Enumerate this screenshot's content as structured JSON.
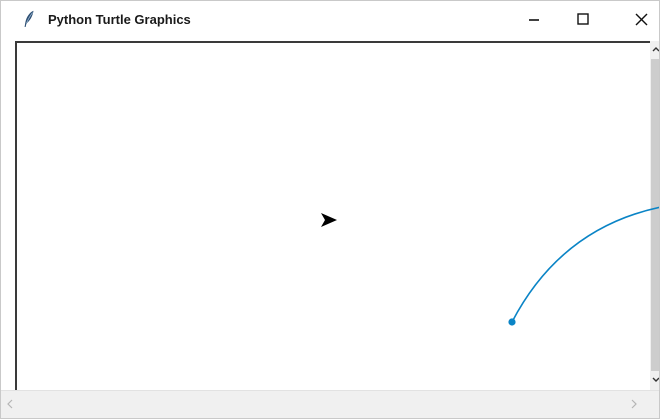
{
  "window": {
    "title": "Python Turtle Graphics",
    "icon": "feather-icon",
    "controls": {
      "minimize_icon": "minimize-icon",
      "maximize_icon": "maximize-icon",
      "close_icon": "close-icon"
    }
  },
  "canvas": {
    "background": "#ffffff",
    "turtle_shape": "arrow-turtle-icon",
    "turtle_color": "#000000",
    "turtle_heading": "east"
  },
  "scrollbars": {
    "vertical_up_icon": "chevron-up-icon",
    "vertical_down_icon": "chevron-down-icon",
    "horizontal_left_icon": "chevron-left-icon",
    "horizontal_right_icon": "chevron-right-icon"
  },
  "annotation": {
    "color": "#0a84c6"
  }
}
